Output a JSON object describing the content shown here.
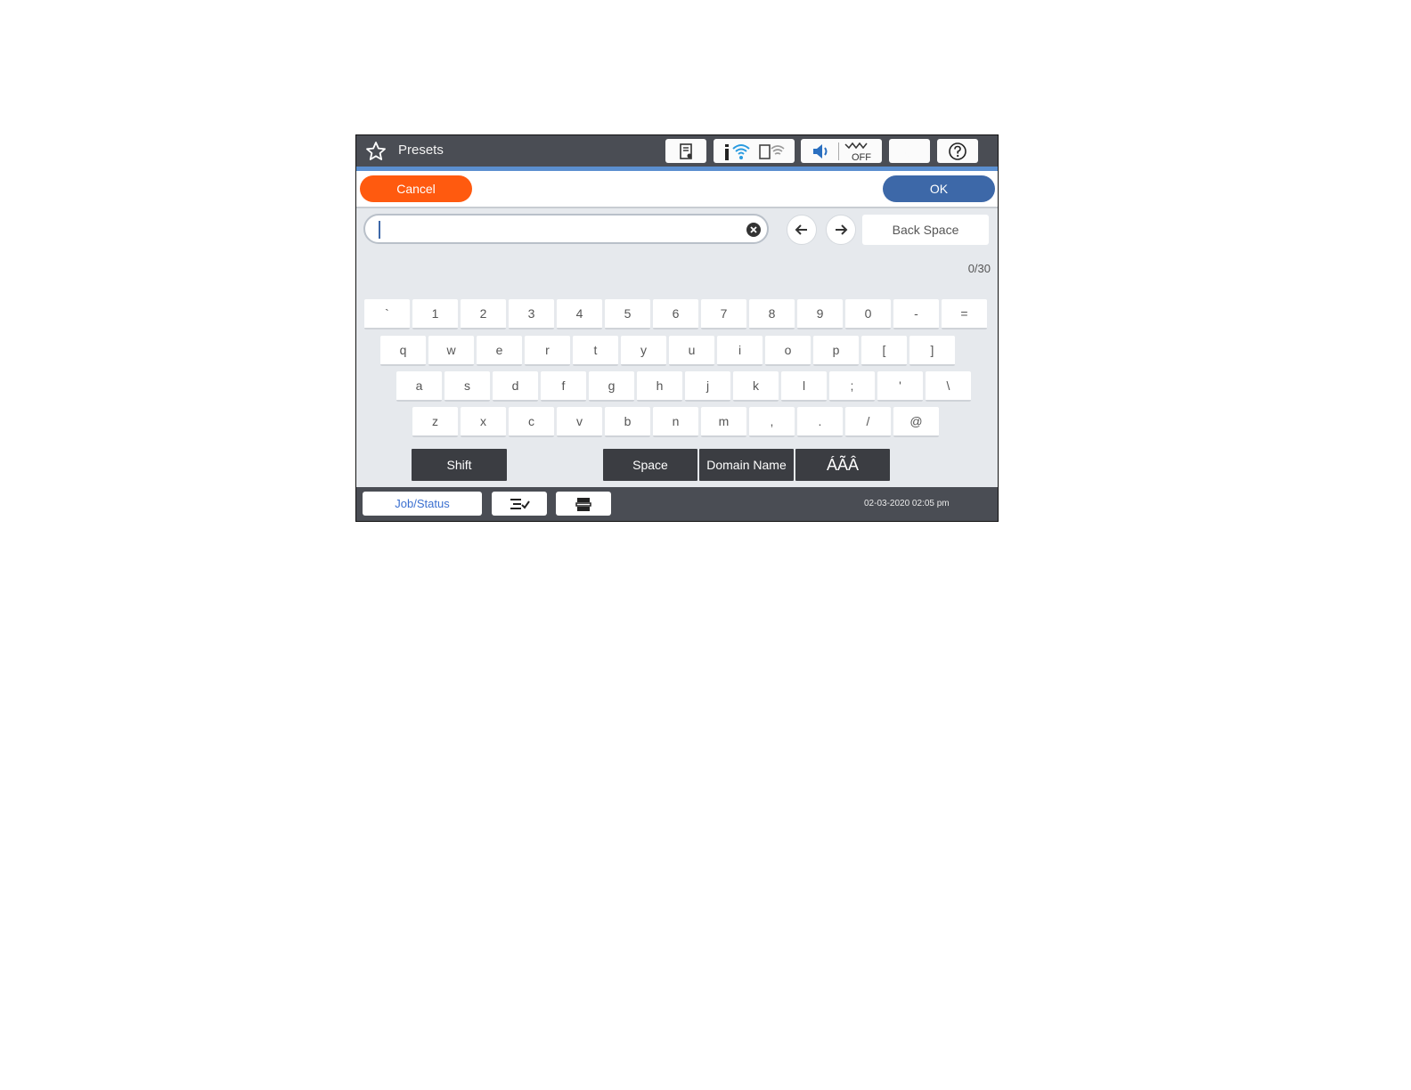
{
  "header": {
    "title": "Presets",
    "title_icon": "star-icon",
    "status_icons": [
      "memory-card-icon",
      "wifi-icon",
      "wifi-direct-icon",
      "speaker-icon",
      "fax-off-icon",
      "sleep-moon-icon",
      "help-icon"
    ],
    "fax_off_text": "OFF"
  },
  "actions": {
    "cancel_label": "Cancel",
    "ok_label": "OK"
  },
  "input": {
    "value": "",
    "back_space_label": "Back Space",
    "char_count": "0/30"
  },
  "keyboard": {
    "row1": [
      "`",
      "1",
      "2",
      "3",
      "4",
      "5",
      "6",
      "7",
      "8",
      "9",
      "0",
      "-",
      "="
    ],
    "row2": [
      "q",
      "w",
      "e",
      "r",
      "t",
      "y",
      "u",
      "i",
      "o",
      "p",
      "[",
      "]"
    ],
    "row3": [
      "a",
      "s",
      "d",
      "f",
      "g",
      "h",
      "j",
      "k",
      "l",
      ";",
      "'",
      "\\"
    ],
    "row4": [
      "z",
      "x",
      "c",
      "v",
      "b",
      "n",
      "m",
      ",",
      ".",
      "/",
      "@"
    ],
    "shift_label": "Shift",
    "space_label": "Space",
    "domain_label": "Domain Name",
    "accent_label": "ÁÃÂ"
  },
  "footer": {
    "job_status_label": "Job/Status",
    "datetime": "02-03-2020 02:05 pm"
  },
  "colors": {
    "cancel": "#ff5a0f",
    "ok": "#3d68a8",
    "header": "#4a4d54",
    "accent_bar": "#5b8fd0"
  }
}
